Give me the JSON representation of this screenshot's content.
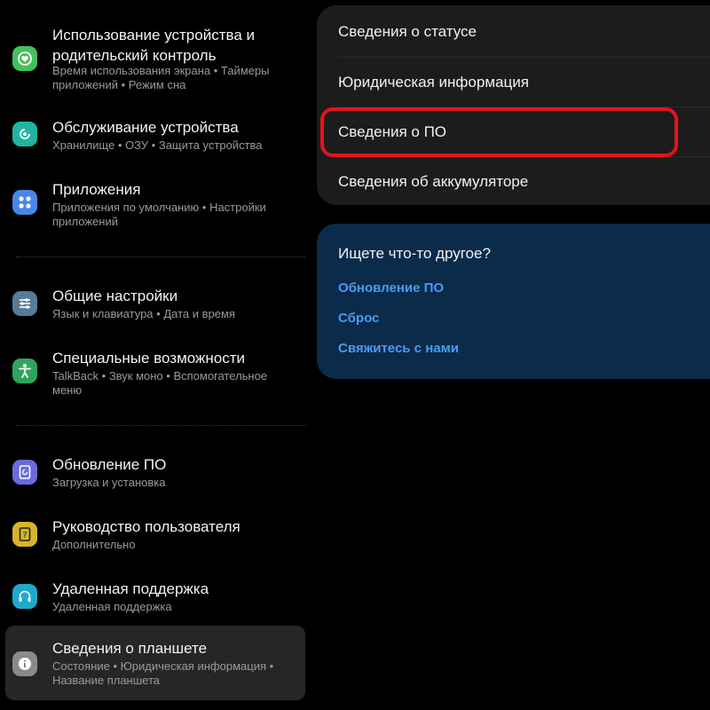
{
  "left_menu": {
    "items": [
      {
        "title": "Использование устройства и родительский контроль",
        "title_lines": [
          "Использование устройства и",
          "родительский контроль"
        ],
        "subtitle": [
          "Время использования экрана",
          "Таймеры приложений",
          "Режим сна"
        ],
        "icon": "heart-balance-icon",
        "color": "#45c15a"
      },
      {
        "title": "Обслуживание устройства",
        "subtitle": [
          "Хранилище",
          "ОЗУ",
          "Защита устройства"
        ],
        "icon": "device-care-icon",
        "color": "#1fb5a0"
      },
      {
        "title": "Приложения",
        "subtitle": [
          "Приложения по умолчанию",
          "Настройки приложений"
        ],
        "icon": "apps-grid-icon",
        "color": "#4a86e8"
      },
      {
        "title": "Общие настройки",
        "subtitle": [
          "Язык и клавиатура",
          "Дата и время"
        ],
        "icon": "sliders-icon",
        "color": "#5a7a99"
      },
      {
        "title": "Специальные возможности",
        "subtitle": [
          "TalkBack",
          "Звук моно",
          "Вспомогательное меню"
        ],
        "icon": "accessibility-icon",
        "color": "#2da65b"
      },
      {
        "title": "Обновление ПО",
        "subtitle": [
          "Загрузка и установка"
        ],
        "icon": "software-update-icon",
        "color": "#6b6be0"
      },
      {
        "title": "Руководство пользователя",
        "subtitle": [
          "Дополнительно"
        ],
        "icon": "user-manual-icon",
        "color": "#d8b42a"
      },
      {
        "title": "Удаленная поддержка",
        "subtitle": [
          "Удаленная поддержка"
        ],
        "icon": "headset-icon",
        "color": "#1faacc"
      },
      {
        "title": "Сведения о планшете",
        "subtitle": [
          "Состояние",
          "Юридическая информация",
          "Название планшета"
        ],
        "icon": "info-icon",
        "color": "#8a8a8a"
      }
    ]
  },
  "about_card": {
    "rows": [
      "Сведения о статусе",
      "Юридическая информация",
      "Сведения о ПО",
      "Сведения об аккумуляторе"
    ],
    "highlighted_row": "Сведения о ПО",
    "highlight_color": "#e4141b"
  },
  "looking_card": {
    "heading": "Ищете что-то другое?",
    "links": [
      "Обновление ПО",
      "Сброс",
      "Свяжитесь с нами"
    ],
    "link_color": "#4a9bf5"
  }
}
